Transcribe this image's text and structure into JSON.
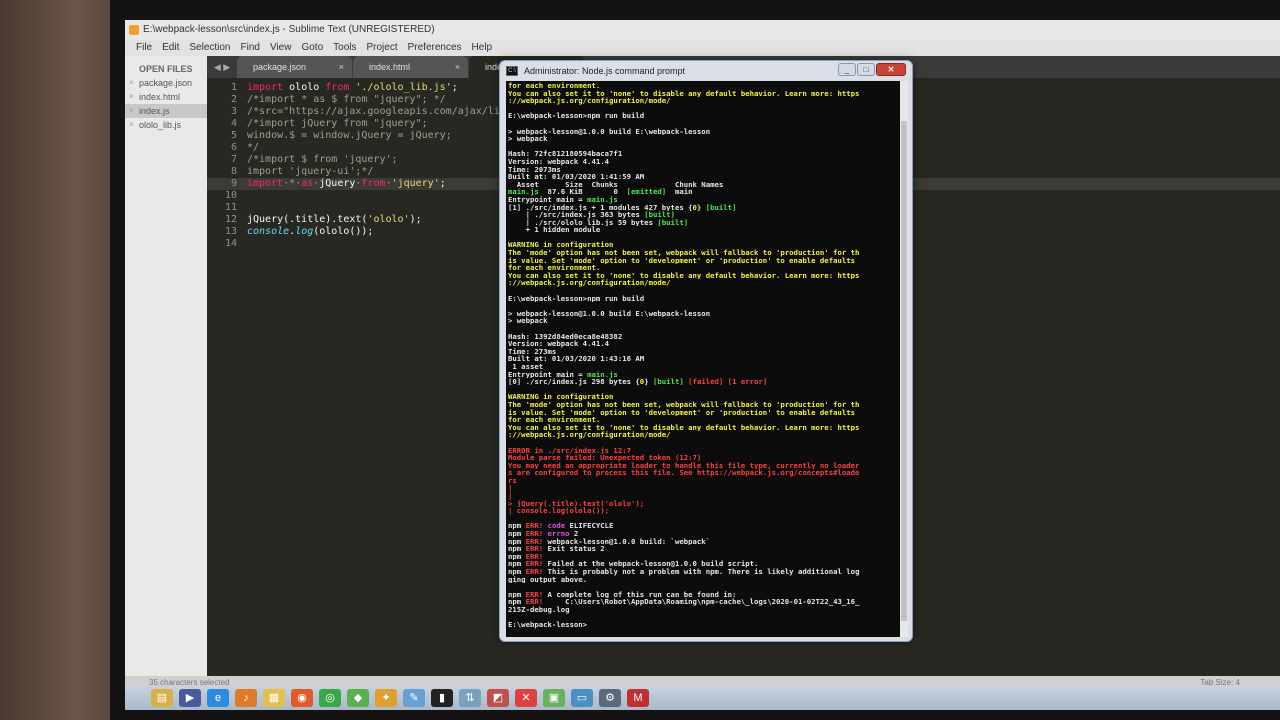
{
  "sublime": {
    "title": "E:\\webpack-lesson\\src\\index.js - Sublime Text (UNREGISTERED)",
    "menu": [
      "File",
      "Edit",
      "Selection",
      "Find",
      "View",
      "Goto",
      "Tools",
      "Project",
      "Preferences",
      "Help"
    ],
    "sidebar": {
      "header": "OPEN FILES",
      "files": [
        "package.json",
        "index.html",
        "index.js",
        "ololo_lib.js"
      ]
    },
    "tabs": [
      "package.json",
      "index.html",
      "index.js"
    ],
    "code_lines": [
      {
        "n": "1",
        "segments": [
          [
            "kw",
            "import "
          ],
          [
            "t",
            "ololo "
          ],
          [
            "kw",
            "from "
          ],
          [
            "str",
            "'./ololo_lib.js'"
          ],
          [
            "t",
            ";"
          ]
        ]
      },
      {
        "n": "2",
        "segments": [
          [
            "cm",
            "/*import * as $ from \"jquery\"; */"
          ]
        ]
      },
      {
        "n": "3",
        "segments": [
          [
            "cm",
            "/*src=\"https://ajax.googleapis.com/ajax/libs/"
          ]
        ]
      },
      {
        "n": "4",
        "segments": [
          [
            "cm",
            "/*import jQuery from \"jquery\";"
          ]
        ]
      },
      {
        "n": "5",
        "segments": [
          [
            "cm",
            "window.$ = window.jQuery = jQuery;"
          ]
        ]
      },
      {
        "n": "6",
        "segments": [
          [
            "cm",
            "*/"
          ]
        ]
      },
      {
        "n": "7",
        "segments": [
          [
            "cm",
            "/*import $ from 'jquery';"
          ]
        ]
      },
      {
        "n": "8",
        "segments": [
          [
            "cm",
            "import 'jquery-ui';*/"
          ]
        ]
      },
      {
        "n": "9",
        "segments": [
          [
            "kw",
            "import"
          ],
          [
            "cm",
            "·*·"
          ],
          [
            "kw",
            "as"
          ],
          [
            "cm",
            "·"
          ],
          [
            "t",
            "jQuery"
          ],
          [
            "cm",
            "·"
          ],
          [
            "kw",
            "from"
          ],
          [
            "cm",
            "·"
          ],
          [
            "str",
            "'jquery'"
          ],
          [
            "t",
            ";"
          ]
        ],
        "highlight": true
      },
      {
        "n": "10",
        "segments": []
      },
      {
        "n": "11",
        "segments": []
      },
      {
        "n": "12",
        "segments": [
          [
            "t",
            "jQuery(.title).text("
          ],
          [
            "str",
            "'ololo'"
          ],
          [
            "t",
            ");"
          ]
        ]
      },
      {
        "n": "13",
        "segments": [
          [
            "fn",
            "console"
          ],
          [
            "t",
            "."
          ],
          [
            "fn",
            "log"
          ],
          [
            "t",
            "(ololo());"
          ]
        ]
      },
      {
        "n": "14",
        "segments": []
      }
    ],
    "status_text": "35 characters selected",
    "tab_size": "Tab Size: 4"
  },
  "console": {
    "title": "Administrator: Node.js command prompt",
    "lines": [
      [
        [
          "y",
          "for each environment."
        ]
      ],
      [
        [
          "y",
          "You can also set it to 'none' to disable any default behavior. Learn more: https"
        ]
      ],
      [
        [
          "y",
          "://webpack.js.org/configuration/mode/"
        ]
      ],
      [
        [
          "w",
          ""
        ]
      ],
      [
        [
          "w",
          "E:\\webpack-lesson>npm run build"
        ]
      ],
      [
        [
          "w",
          ""
        ]
      ],
      [
        [
          "w",
          "> webpack-lesson@1.0.0 build E:\\webpack-lesson"
        ]
      ],
      [
        [
          "w",
          "> webpack"
        ]
      ],
      [
        [
          "w",
          ""
        ]
      ],
      [
        [
          "w",
          "Hash: 72fc812180594baca7f1"
        ]
      ],
      [
        [
          "w",
          "Version: webpack 4.41.4"
        ]
      ],
      [
        [
          "w",
          "Time: 2073ms"
        ]
      ],
      [
        [
          "w",
          "Built at: 01/03/2020 1:41:59 AM"
        ]
      ],
      [
        [
          "w",
          "  Asset      Size  Chunks             Chunk Names"
        ]
      ],
      [
        [
          "g",
          "main.js"
        ],
        [
          "w",
          "  87.6 KiB       0  "
        ],
        [
          "g",
          "[emitted]"
        ],
        [
          "w",
          "  main"
        ]
      ],
      [
        [
          "w",
          "Entrypoint main = "
        ],
        [
          "g",
          "main.js"
        ]
      ],
      [
        [
          "w",
          "[1] ./src/index.js + 1 modules 427 bytes {"
        ],
        [
          "y",
          "0"
        ],
        [
          "w",
          "} "
        ],
        [
          "g",
          "[built]"
        ]
      ],
      [
        [
          "w",
          "    | ./src/index.js 363 bytes "
        ],
        [
          "g",
          "[built]"
        ]
      ],
      [
        [
          "w",
          "    | ./src/ololo_lib.js 59 bytes "
        ],
        [
          "g",
          "[built]"
        ]
      ],
      [
        [
          "w",
          "    + 1 hidden module"
        ]
      ],
      [
        [
          "w",
          ""
        ]
      ],
      [
        [
          "y",
          "WARNING in configuration"
        ]
      ],
      [
        [
          "y",
          "The 'mode' option has not been set, webpack will fallback to 'production' for th"
        ]
      ],
      [
        [
          "y",
          "is value. Set 'mode' option to 'development' or 'production' to enable defaults"
        ]
      ],
      [
        [
          "y",
          "for each environment."
        ]
      ],
      [
        [
          "y",
          "You can also set it to 'none' to disable any default behavior. Learn more: https"
        ]
      ],
      [
        [
          "y",
          "://webpack.js.org/configuration/mode/"
        ]
      ],
      [
        [
          "w",
          ""
        ]
      ],
      [
        [
          "w",
          "E:\\webpack-lesson>npm run build"
        ]
      ],
      [
        [
          "w",
          ""
        ]
      ],
      [
        [
          "w",
          "> webpack-lesson@1.0.0 build E:\\webpack-lesson"
        ]
      ],
      [
        [
          "w",
          "> webpack"
        ]
      ],
      [
        [
          "w",
          ""
        ]
      ],
      [
        [
          "w",
          "Hash: 1392d84ed0eca8e48382"
        ]
      ],
      [
        [
          "w",
          "Version: webpack 4.41.4"
        ]
      ],
      [
        [
          "w",
          "Time: 273ms"
        ]
      ],
      [
        [
          "w",
          "Built at: 01/03/2020 1:43:16 AM"
        ]
      ],
      [
        [
          "w",
          " 1 asset"
        ]
      ],
      [
        [
          "w",
          "Entrypoint main = "
        ],
        [
          "g",
          "main.js"
        ]
      ],
      [
        [
          "w",
          "[0] ./src/index.js 298 bytes {"
        ],
        [
          "y",
          "0"
        ],
        [
          "w",
          "} "
        ],
        [
          "g",
          "[built]"
        ],
        [
          "r",
          " [failed] [1 error]"
        ]
      ],
      [
        [
          "w",
          ""
        ]
      ],
      [
        [
          "y",
          "WARNING in configuration"
        ]
      ],
      [
        [
          "y",
          "The 'mode' option has not been set, webpack will fallback to 'production' for th"
        ]
      ],
      [
        [
          "y",
          "is value. Set 'mode' option to 'development' or 'production' to enable defaults"
        ]
      ],
      [
        [
          "y",
          "for each environment."
        ]
      ],
      [
        [
          "y",
          "You can also set it to 'none' to disable any default behavior. Learn more: https"
        ]
      ],
      [
        [
          "y",
          "://webpack.js.org/configuration/mode/"
        ]
      ],
      [
        [
          "w",
          ""
        ]
      ],
      [
        [
          "r",
          "ERROR in ./src/index.js 12:7"
        ]
      ],
      [
        [
          "r",
          "Module parse failed: Unexpected token (12:7)"
        ]
      ],
      [
        [
          "r",
          "You may need an appropriate loader to handle this file type, currently no loader"
        ]
      ],
      [
        [
          "r",
          "s are configured to process this file. See https://webpack.js.org/concepts#loade"
        ]
      ],
      [
        [
          "r",
          "rs"
        ]
      ],
      [
        [
          "r",
          "|"
        ]
      ],
      [
        [
          "r",
          "|"
        ]
      ],
      [
        [
          "r",
          "> jQuery(.title).text('ololo');"
        ]
      ],
      [
        [
          "r",
          "| console.log(ololo());"
        ]
      ],
      [
        [
          "w",
          ""
        ]
      ],
      [
        [
          "w",
          "npm "
        ],
        [
          "r",
          "ERR!"
        ],
        [
          "m",
          " code"
        ],
        [
          "w",
          " ELIFECYCLE"
        ]
      ],
      [
        [
          "w",
          "npm "
        ],
        [
          "r",
          "ERR!"
        ],
        [
          "m",
          " errno"
        ],
        [
          "w",
          " 2"
        ]
      ],
      [
        [
          "w",
          "npm "
        ],
        [
          "r",
          "ERR!"
        ],
        [
          "w",
          " webpack-lesson@1.0.0 build: `webpack`"
        ]
      ],
      [
        [
          "w",
          "npm "
        ],
        [
          "r",
          "ERR!"
        ],
        [
          "w",
          " Exit status 2"
        ]
      ],
      [
        [
          "w",
          "npm "
        ],
        [
          "r",
          "ERR!"
        ]
      ],
      [
        [
          "w",
          "npm "
        ],
        [
          "r",
          "ERR!"
        ],
        [
          "w",
          " Failed at the webpack-lesson@1.0.0 build script."
        ]
      ],
      [
        [
          "w",
          "npm "
        ],
        [
          "r",
          "ERR!"
        ],
        [
          "w",
          " This is probably not a problem with npm. There is likely additional log"
        ]
      ],
      [
        [
          "w",
          "ging output above."
        ]
      ],
      [
        [
          "w",
          ""
        ]
      ],
      [
        [
          "w",
          "npm "
        ],
        [
          "r",
          "ERR!"
        ],
        [
          "w",
          " A complete log of this run can be found in:"
        ]
      ],
      [
        [
          "w",
          "npm "
        ],
        [
          "r",
          "ERR!"
        ],
        [
          "w",
          "     C:\\Users\\Robot\\AppData\\Roaming\\npm-cache\\_logs\\2020-01-02T22_43_16_"
        ]
      ],
      [
        [
          "w",
          "215Z-debug.log"
        ]
      ],
      [
        [
          "w",
          ""
        ]
      ],
      [
        [
          "w",
          "E:\\webpack-lesson>"
        ]
      ]
    ]
  },
  "taskbar": {
    "icons": [
      "folder-icon",
      "media-player-icon",
      "internet-explorer-icon",
      "music-icon",
      "explorer-icon",
      "firefox-icon",
      "chrome-icon",
      "android-icon",
      "bulb-icon",
      "notepad-icon",
      "cmd-icon",
      "network-icon",
      "app-icon",
      "close-icon",
      "image-icon",
      "monitor-icon",
      "tool-icon",
      "mail-icon"
    ]
  },
  "colors": {
    "editor_bg": "#272822",
    "terminal_bg": "#0c0c0c",
    "warning_yellow": "#f2f244",
    "error_red": "#ff4040",
    "success_green": "#4ee64e"
  }
}
